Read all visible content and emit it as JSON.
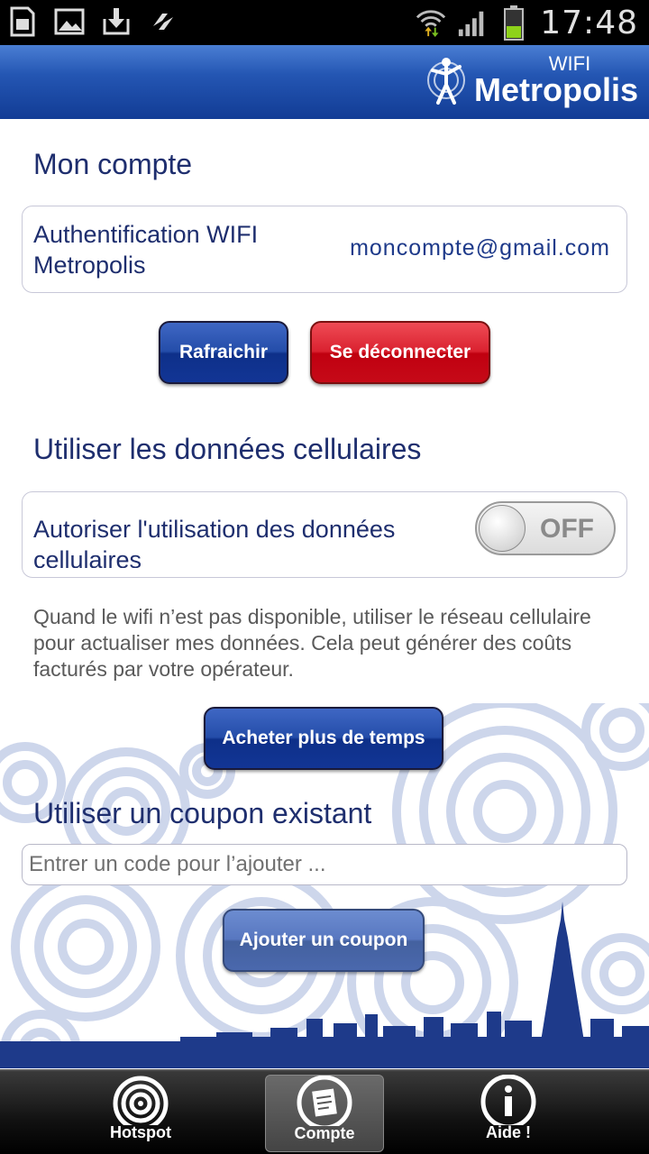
{
  "status_bar": {
    "time": "17:48",
    "icons": [
      "sim-card-icon",
      "image-icon",
      "download-icon",
      "sync-icon",
      "wifi-icon",
      "signal-icon",
      "battery-icon"
    ]
  },
  "header": {
    "logo_small": "WIFI",
    "logo_large": "Metropolis",
    "brand_color": "#2456b3"
  },
  "account": {
    "title": "Mon compte",
    "auth_label": "Authentification WIFI Metropolis",
    "email": "moncompte@gmail.com",
    "refresh_label": "Rafraichir",
    "logout_label": "Se déconnecter"
  },
  "cellular": {
    "title": "Utiliser les données cellulaires",
    "toggle_label": "Autoriser l'utilisation des données cellulaires",
    "toggle_state": "OFF",
    "description": "Quand le wifi n’est pas disponible, utiliser le réseau cellulaire pour actualiser mes données. Cela peut générer des coûts facturés par votre opérateur.",
    "buy_label": "Acheter plus de temps"
  },
  "coupon": {
    "title": "Utiliser un coupon existant",
    "input_value": "",
    "input_placeholder": "Entrer un code pour l’ajouter ...",
    "add_label": "Ajouter un coupon"
  },
  "tabs": [
    {
      "label": "Hotspot",
      "icon": "hotspot-icon",
      "active": false
    },
    {
      "label": "Compte",
      "icon": "account-icon",
      "active": true
    },
    {
      "label": "Aide !",
      "icon": "info-icon",
      "active": false
    }
  ],
  "colors": {
    "title_color": "#1e2e6e",
    "button_blue": "#123595",
    "button_red": "#c00010"
  }
}
